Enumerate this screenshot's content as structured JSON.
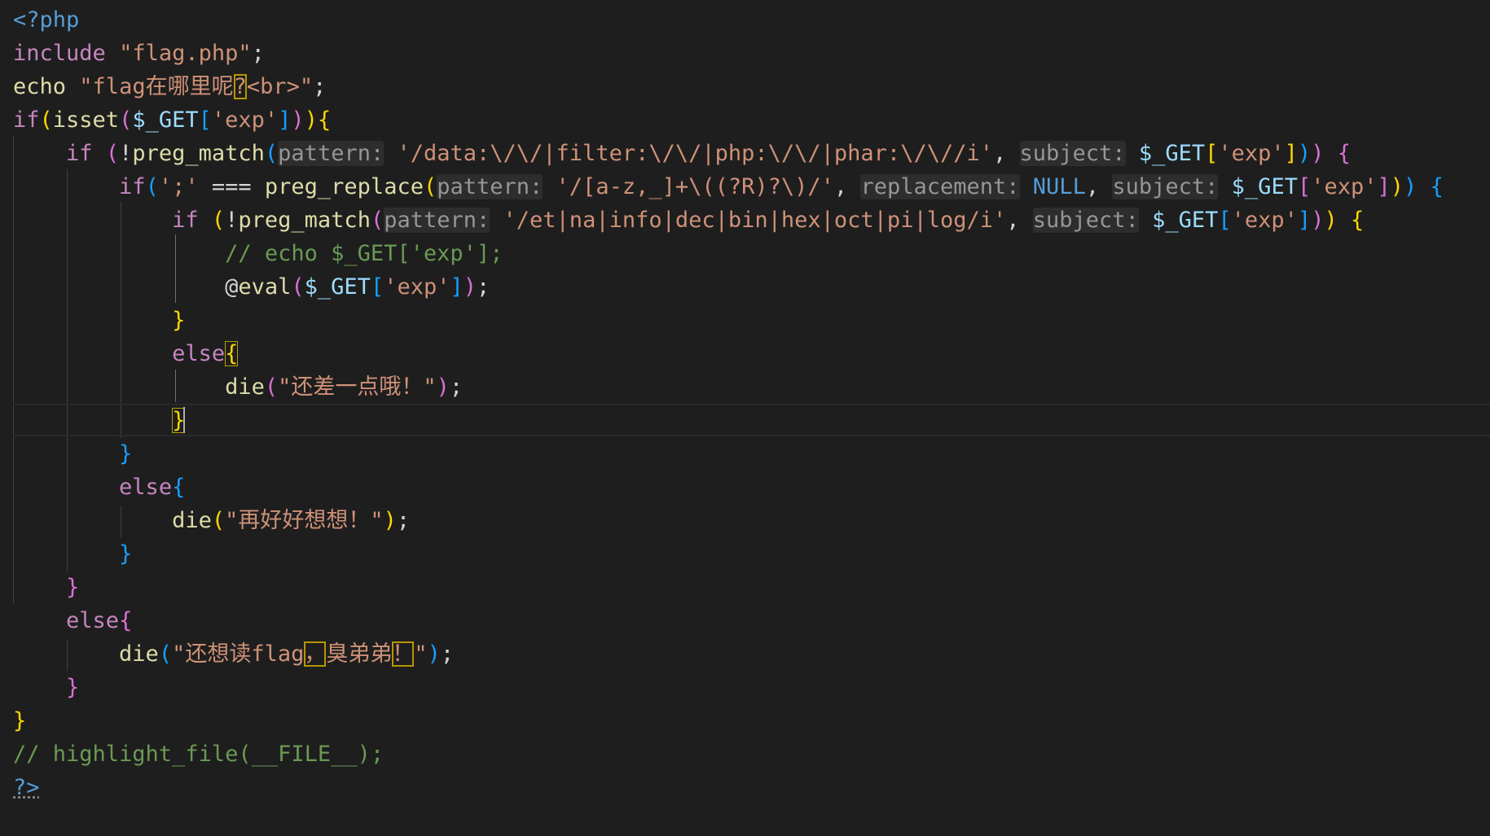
{
  "code": {
    "l1": {
      "open_tag": "<?php"
    },
    "l2": {
      "include": "include",
      "path": "\"flag.php\"",
      "semi": ";"
    },
    "l3": {
      "echo": "echo",
      "str_a": "\"flag在哪里呢",
      "qmark": "?",
      "str_b": "<br>\"",
      "semi": ";"
    },
    "l4": {
      "if": "if",
      "p1": "(",
      "isset": "isset",
      "p2": "(",
      "var": "$_GET",
      "b1": "[",
      "key": "'exp'",
      "b2": "]",
      "p3": ")",
      "p4": ")",
      "brace": "{"
    },
    "l5": {
      "if": "if",
      "paren": "(",
      "bang": "!",
      "func": "preg_match",
      "fparen": "(",
      "hint_pattern": "pattern:",
      "regex": "'/data:\\/\\/|filter:\\/\\/|php:\\/\\/|phar:\\/\\//i'",
      "comma": ",",
      "hint_subject": "subject:",
      "var": "$_GET",
      "b1": "[",
      "key": "'exp'",
      "b2": "]",
      "close_f": ")",
      "close_p": ")",
      "brace": "{"
    },
    "l6": {
      "if": "if",
      "paren": "(",
      "semi_str": "';'",
      "op": " === ",
      "func": "preg_replace",
      "fparen": "(",
      "hint_pattern": "pattern:",
      "regex": "'/[a-z,_]+\\((?R)?\\)/'",
      "comma1": ",",
      "hint_replacement": "replacement:",
      "null": "NULL",
      "comma2": ",",
      "hint_subject": "subject:",
      "var": "$_GET",
      "b1": "[",
      "key": "'exp'",
      "b2": "]",
      "close_f": ")",
      "close_p": ")",
      "brace": "{"
    },
    "l7": {
      "if": "if",
      "paren": "(",
      "bang": "!",
      "func": "preg_match",
      "fparen": "(",
      "hint_pattern": "pattern:",
      "regex": "'/et|na|info|dec|bin|hex|oct|pi|log/i'",
      "comma": ",",
      "hint_subject": "subject:",
      "var": "$_GET",
      "b1": "[",
      "key": "'exp'",
      "b2": "]",
      "close_f": ")",
      "close_p": ")",
      "brace": "{"
    },
    "l8": {
      "comment": "// echo $_GET['exp'];"
    },
    "l9": {
      "at": "@",
      "func": "eval",
      "paren": "(",
      "var": "$_GET",
      "b1": "[",
      "key": "'exp'",
      "b2": "]",
      "close": ")",
      "semi": ";"
    },
    "l10": {
      "brace": "}"
    },
    "l11": {
      "else": "else",
      "brace": "{"
    },
    "l12": {
      "func": "die",
      "paren": "(",
      "str": "\"还差一点哦！\"",
      "close": ")",
      "semi": ";"
    },
    "l13": {
      "brace": "}"
    },
    "l14": {
      "brace": "}"
    },
    "l15": {
      "else": "else",
      "brace": "{"
    },
    "l16": {
      "func": "die",
      "paren": "(",
      "str": "\"再好好想想！\"",
      "close": ")",
      "semi": ";"
    },
    "l17": {
      "brace": "}"
    },
    "l18": {
      "brace": "}"
    },
    "l19": {
      "else": "else",
      "brace": "{"
    },
    "l20": {
      "func": "die",
      "paren": "(",
      "str_a": "\"还想读flag",
      "comma_cn": "，",
      "str_b": "臭弟弟",
      "bang_cn": "！",
      "str_c": "\"",
      "close": ")",
      "semi": ";"
    },
    "l21": {
      "brace": "}"
    },
    "l22": {
      "brace": "}"
    },
    "l23": {
      "comment": "// highlight_file(__FILE__);"
    },
    "l24": {
      "close_tag": "?>"
    }
  },
  "theme": {
    "background": "#1e1e1e",
    "keyword": "#c586c0",
    "function": "#dcdcaa",
    "string": "#ce9178",
    "variable": "#9cdcfe",
    "comment": "#6a9955",
    "tag": "#569cd6",
    "bracket_gold": "#ffd700",
    "bracket_pink": "#da70d6",
    "bracket_blue": "#179fff"
  }
}
